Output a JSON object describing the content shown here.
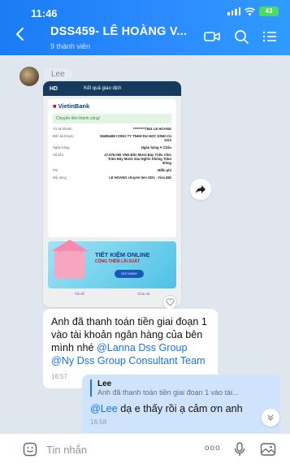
{
  "status_bar": {
    "time": "11:46",
    "battery": "43"
  },
  "header": {
    "title": "DSS459- LÊ HOÀNG V...",
    "subtitle": "9 thành viên",
    "icons": [
      "back-arrow-icon",
      "video-call-icon",
      "search-icon",
      "menu-icon"
    ]
  },
  "messages": {
    "first_sender": "Lee",
    "image_message": {
      "app_bar_title": "Kết quả giao dịch",
      "bank_name": "VietinBank",
      "success_text": "Chuyển tiền thành công!",
      "rows": [
        {
          "label": "Từ tài khoản",
          "value": "*********7541 LE HOANG"
        },
        {
          "label": "Đến tài khoản",
          "value": "55455468 CONG TY TNHH DU HOC DINH CU DSS"
        },
        {
          "label": "Ngân hàng",
          "value": "Ngân hàng A Châu"
        },
        {
          "label": "Số tiền",
          "value": "47.976.000 VND Bốn Mươi Bảy Triệu Chín Trăm Bảy Mươi Sáu Nghìn Không Trăm Đồng"
        },
        {
          "label": "Phí",
          "value": "Miễn phí"
        },
        {
          "label": "Nội dung",
          "value": "LE HOANG chuyen tien GD1 - Visa 482"
        }
      ],
      "promo_title": "TIẾT KIỆM ONLINE",
      "promo_subtitle": "CỘNG THÊM LÃI SUẤT",
      "promo_button": "GỬI NGAY",
      "bottom_actions": [
        "Tải về",
        "Chia sẻ"
      ]
    },
    "text_message": {
      "text_before": "Anh đã thanh toán tiền giai đoạn 1 vào tài khoản ngân hàng của bên mình nhé ",
      "mention1": "@Lanna Dss Group",
      "mention2": "@Ny Dss Group Consultant Team",
      "time": "16:57"
    },
    "reply_message": {
      "quote_name": "Lee",
      "quote_text": "Anh đã thanh toán tiền giai đoạn 1 vào tài...",
      "mention": "@Lee",
      "text": " dạ e thấy rồi ạ cảm ơn anh",
      "time": "16:58"
    }
  },
  "composer": {
    "placeholder": "Tin nhắn",
    "more_label": "ooo"
  },
  "colors": {
    "header": "#2c8cff",
    "outgoing_bubble": "#cfe3fd",
    "mention": "#1a73e8"
  }
}
